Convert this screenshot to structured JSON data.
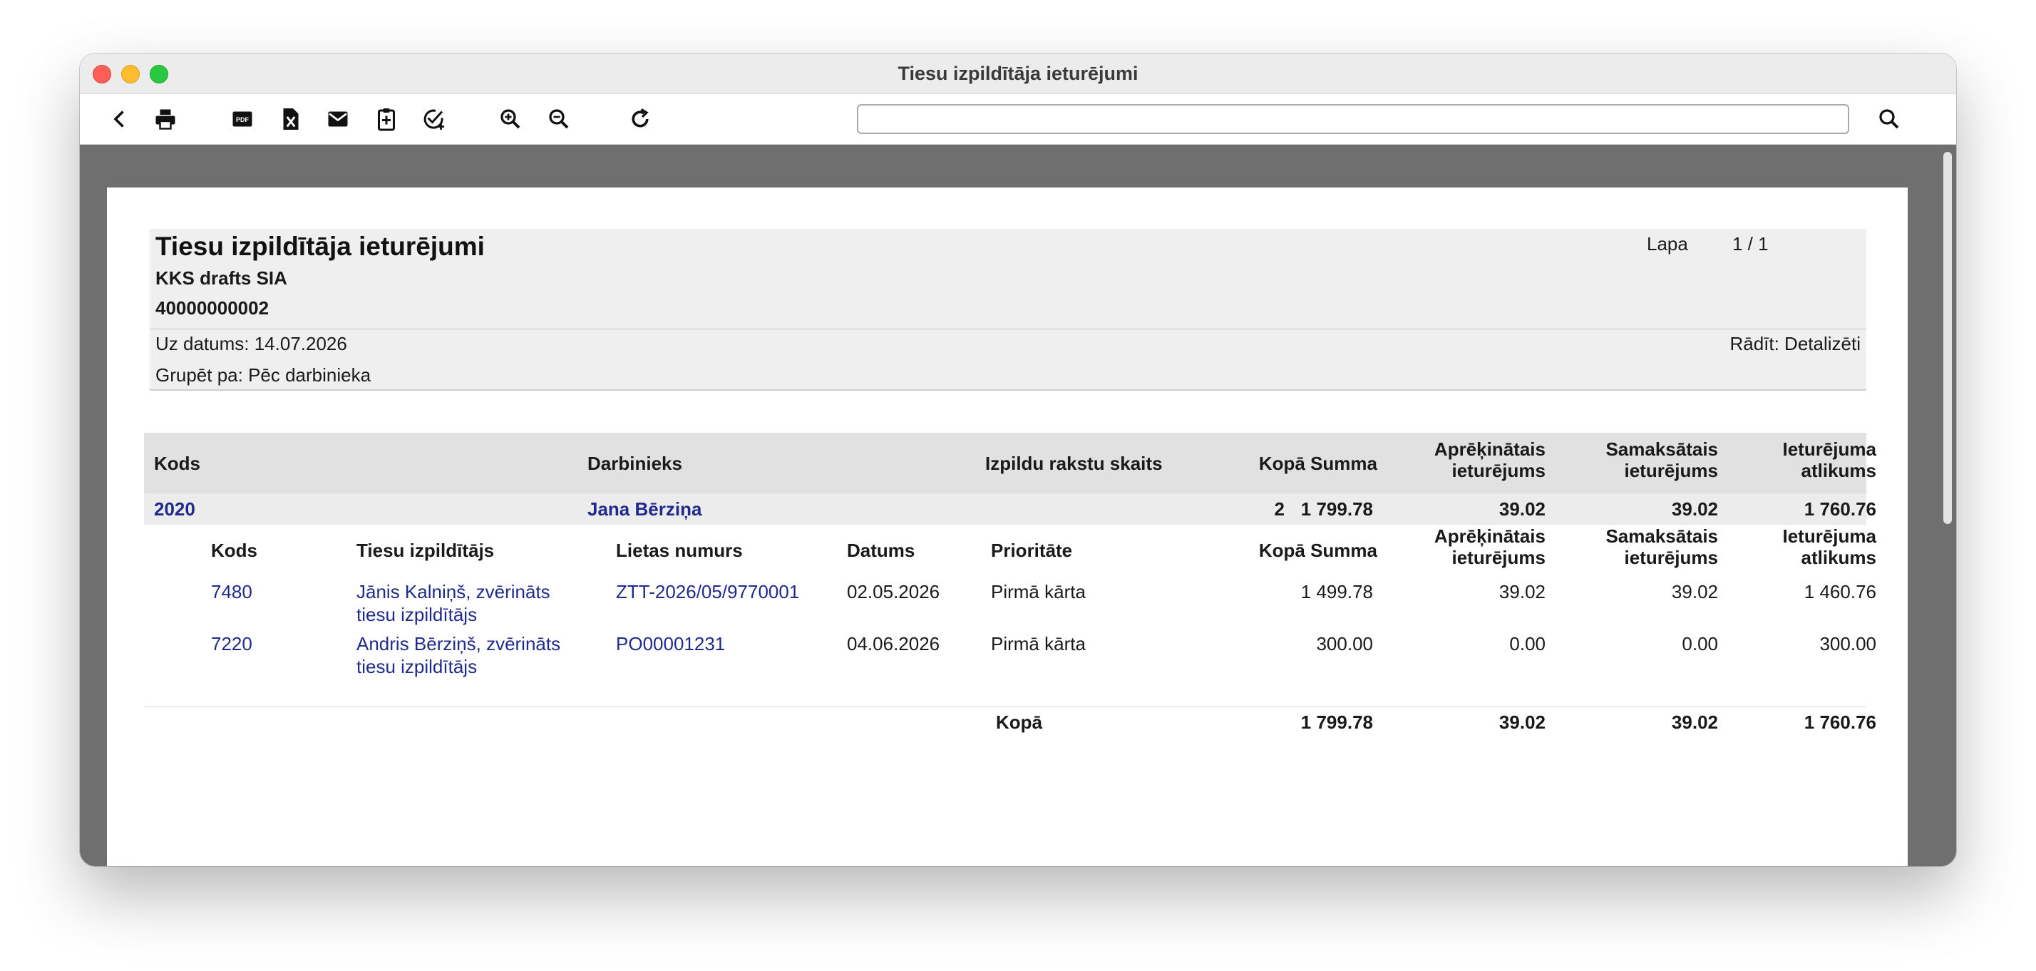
{
  "window": {
    "title": "Tiesu izpildītāja ieturējumi"
  },
  "toolbar": {
    "buttons": [
      "back-icon",
      "print-icon",
      "pdf-icon",
      "excel-icon",
      "mail-icon",
      "clipboard-icon",
      "approve-icon",
      "zoom-in-icon",
      "zoom-out-icon",
      "refresh-icon"
    ],
    "search_value": "",
    "search_icon": "search-icon"
  },
  "report": {
    "title": "Tiesu izpildītāja ieturējumi",
    "company": "KKS drafts SIA",
    "reg_no": "40000000002",
    "date": "Uz datums: 14.07.2026",
    "group_by": "Grupēt pa: Pēc darbinieka",
    "page_label": "Lapa",
    "page_value": "1 / 1",
    "show": "Rādīt: Detalizēti"
  },
  "columns": {
    "code": "Kods",
    "employee": "Darbinieks",
    "writs_count": "Izpildu rakstu skaits",
    "total": "Kopā Summa",
    "calculated_1": "Aprēķinātais",
    "calculated_2": "ieturējums",
    "paid_1": "Samaksātais",
    "paid_2": "ieturējums",
    "balance_1": "Ieturējuma",
    "balance_2": "atlikums"
  },
  "group": {
    "code": "2020",
    "employee": "Jana Bērziņa",
    "writs_count": "2",
    "total": "1 799.78",
    "calculated": "39.02",
    "paid": "39.02",
    "balance": "1 760.76"
  },
  "detail_columns": {
    "code": "Kods",
    "bailiff": "Tiesu izpildītājs",
    "case_no": "Lietas numurs",
    "date": "Datums",
    "priority": "Prioritāte",
    "total": "Kopā Summa",
    "calculated_1": "Aprēķinātais",
    "calculated_2": "ieturējums",
    "paid_1": "Samaksātais",
    "paid_2": "ieturējums",
    "balance_1": "Ieturējuma",
    "balance_2": "atlikums"
  },
  "rows": [
    {
      "code": "7480",
      "bailiff_1": "Jānis Kalniņš, zvērināts",
      "bailiff_2": "tiesu izpildītājs",
      "case_no": "ZTT-2026/05/9770001",
      "date": "02.05.2026",
      "priority": "Pirmā kārta",
      "total": "1 499.78",
      "calculated": "39.02",
      "paid": "39.02",
      "balance": "1 460.76"
    },
    {
      "code": "7220",
      "bailiff_1": "Andris Bērziņš, zvērināts",
      "bailiff_2": "tiesu izpildītājs",
      "case_no": "PO00001231",
      "date": "04.06.2026",
      "priority": "Pirmā kārta",
      "total": "300.00",
      "calculated": "0.00",
      "paid": "0.00",
      "balance": "300.00"
    }
  ],
  "totals": {
    "label": "Kopā",
    "total": "1 799.78",
    "calculated": "39.02",
    "paid": "39.02",
    "balance": "1 760.76"
  }
}
